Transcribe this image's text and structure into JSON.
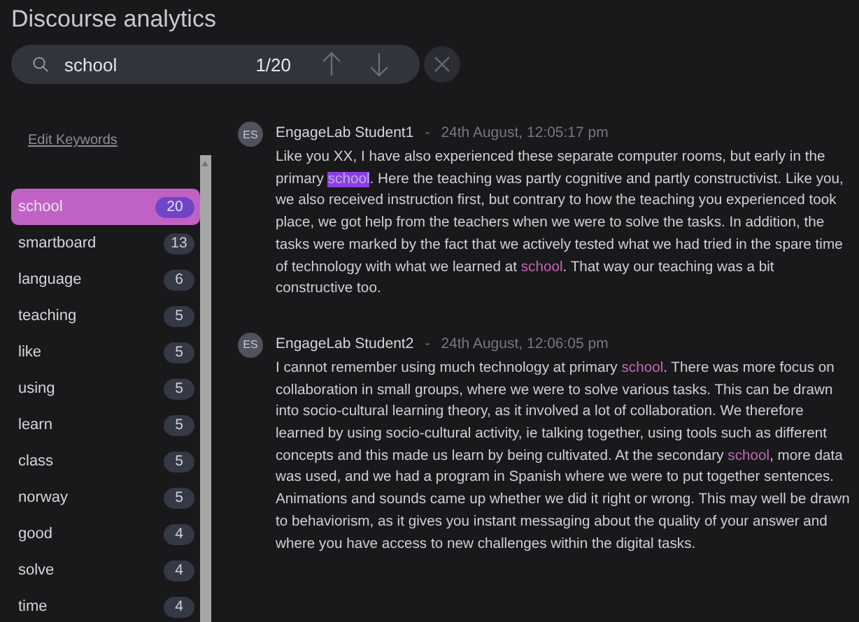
{
  "window": {
    "title": "Discourse analytics"
  },
  "search": {
    "value": "school",
    "match_counter": "1/20"
  },
  "edit_keywords_link": "Edit Keywords",
  "keywords": [
    {
      "label": "school",
      "count": "20",
      "selected": true
    },
    {
      "label": "smartboard",
      "count": "13",
      "selected": false
    },
    {
      "label": "language",
      "count": "6",
      "selected": false
    },
    {
      "label": "teaching",
      "count": "5",
      "selected": false
    },
    {
      "label": "like",
      "count": "5",
      "selected": false
    },
    {
      "label": "using",
      "count": "5",
      "selected": false
    },
    {
      "label": "learn",
      "count": "5",
      "selected": false
    },
    {
      "label": "class",
      "count": "5",
      "selected": false
    },
    {
      "label": "norway",
      "count": "5",
      "selected": false
    },
    {
      "label": "good",
      "count": "4",
      "selected": false
    },
    {
      "label": "solve",
      "count": "4",
      "selected": false
    },
    {
      "label": "time",
      "count": "4",
      "selected": false
    }
  ],
  "messages": [
    {
      "avatar": "ES",
      "author": "EngageLab Student1",
      "separator": "-",
      "time": "24th August, 12:05:17 pm",
      "segments": [
        {
          "kind": "text",
          "text": "Like you XX, I have also experienced these separate computer rooms, but early in the primary "
        },
        {
          "kind": "current_match",
          "text": "school"
        },
        {
          "kind": "text",
          "text": ". Here the teaching was partly cognitive and partly constructivist. Like you, we also received instruction first, but contrary to how the teaching you experienced took place, we got help from the teachers when we were to solve the tasks. In addition, the tasks were marked by the fact that we actively tested what we had tried in the spare time of technology with what we learned at "
        },
        {
          "kind": "match",
          "text": "school"
        },
        {
          "kind": "text",
          "text": ". That way our teaching was a bit constructive too."
        }
      ]
    },
    {
      "avatar": "ES",
      "author": "EngageLab Student2",
      "separator": "-",
      "time": "24th August, 12:06:05 pm",
      "segments": [
        {
          "kind": "text",
          "text": "I cannot remember using much technology at primary "
        },
        {
          "kind": "match",
          "text": "school"
        },
        {
          "kind": "text",
          "text": ". There was more focus on collaboration in small groups, where we were to solve various tasks. This can be drawn into socio-cultural learning theory, as it involved a lot of collaboration. We therefore learned by using socio-cultural activity, ie talking together, using tools such as different concepts and this made us learn by being cultivated. At the secondary "
        },
        {
          "kind": "match",
          "text": "school"
        },
        {
          "kind": "text",
          "text": ", more data was used, and we had a program in Spanish where we were to put together sentences. Animations and sounds came up whether we did it right or wrong. This may well be drawn to behaviorism, as it gives you instant messaging about the quality of your answer and where you have access to new challenges within the digital tasks."
        }
      ]
    }
  ]
}
